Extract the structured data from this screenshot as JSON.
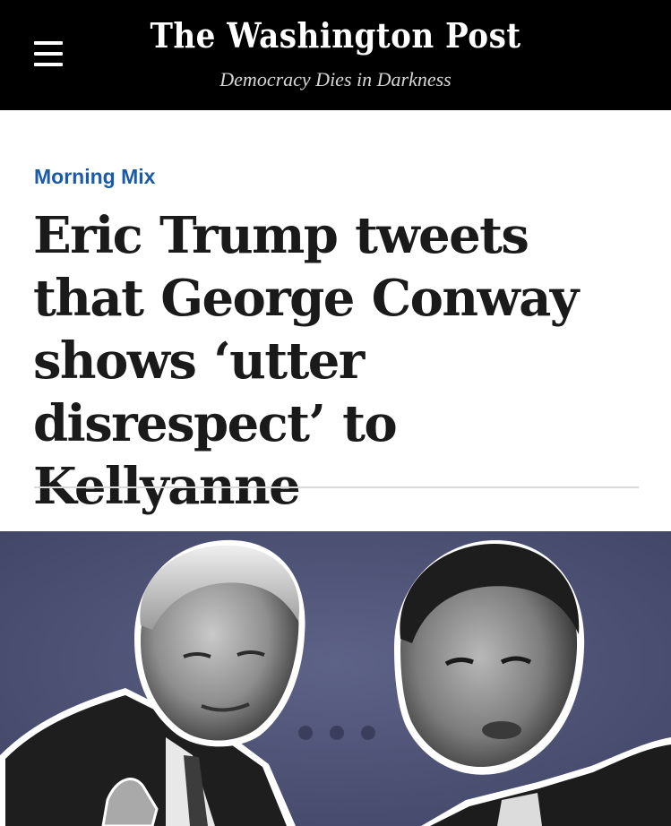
{
  "masthead": {
    "logo": "The Washington Post",
    "tagline": "Democracy Dies in Darkness",
    "menu_icon": "hamburger-menu-icon"
  },
  "article": {
    "kicker": "Morning Mix",
    "headline": "Eric Trump tweets that George Conway shows ‘utter disrespect’ to Kellyanne"
  },
  "lead_image": {
    "description_icon": "photo-collage-icon"
  },
  "colors": {
    "masthead_bg": "#000000",
    "kicker": "#1a5aa6",
    "headline": "#1a1a1a",
    "image_bg": "#4e5378"
  }
}
